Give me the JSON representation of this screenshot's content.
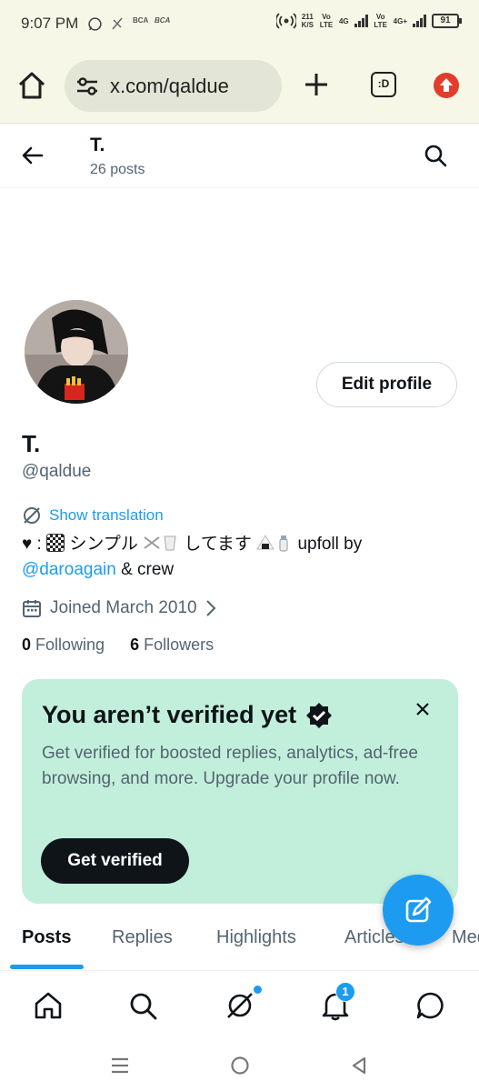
{
  "status_bar": {
    "time": "9:07 PM",
    "notif_icons": [
      "whatsapp-icon",
      "signal-off-icon",
      "bca-icon",
      "bca-mobile-icon"
    ],
    "bca_label": "BCA",
    "net_speed": "211",
    "net_unit": "K/S",
    "lte1": "Vo LTE",
    "net1": "4G",
    "lte2": "Vo LTE",
    "net2": "4G+",
    "battery": "91"
  },
  "browser": {
    "url": "x.com/qaldue",
    "tab_label": ":D"
  },
  "header": {
    "name": "T.",
    "posts": "26 posts"
  },
  "profile": {
    "edit_label": "Edit profile",
    "display_name": "T.",
    "handle": "@qaldue",
    "translate_label": "Show translation",
    "bio_line1_a": "♥ : ",
    "bio_line1_b": " シンプル ",
    "bio_line1_c": " してます ",
    "bio_line1_d": " upfoll by",
    "bio_mention": "@daroagain",
    "bio_line2_rest": " & crew",
    "joined": "Joined March 2010",
    "following_count": "0",
    "following_label": "Following",
    "followers_count": "6",
    "followers_label": "Followers"
  },
  "verify_card": {
    "title": "You aren’t verified yet",
    "body": "Get verified for boosted replies, analytics, ad-free browsing, and more. Upgrade your profile now.",
    "button": "Get verified"
  },
  "tabs": [
    {
      "label": "Posts",
      "active": true
    },
    {
      "label": "Replies",
      "active": false
    },
    {
      "label": "Highlights",
      "active": false
    },
    {
      "label": "Articles",
      "active": false
    },
    {
      "label": "Media",
      "active": false
    }
  ],
  "bottom_nav": {
    "items": [
      "home-icon",
      "search-icon",
      "grok-icon",
      "notifications-icon",
      "messages-icon"
    ],
    "notification_count": "1"
  },
  "colors": {
    "accent": "#1d9bf0",
    "card": "#c2efdb",
    "text": "#0f1419",
    "muted": "#536471"
  }
}
